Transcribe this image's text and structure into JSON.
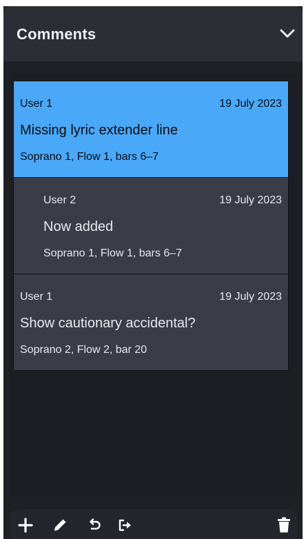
{
  "panel": {
    "title": "Comments",
    "collapse_icon": "chevron-down-icon"
  },
  "comments": [
    {
      "author": "User 1",
      "date": "19 July 2023",
      "text": "Missing lyric extender line",
      "location": "Soprano 1, Flow 1, bars 6–7",
      "selected": true,
      "reply": false
    },
    {
      "author": "User 2",
      "date": "19 July 2023",
      "text": "Now added",
      "location": "Soprano 1, Flow 1, bars 6–7",
      "selected": false,
      "reply": true
    },
    {
      "author": "User 1",
      "date": "19 July 2023",
      "text": "Show cautionary accidental?",
      "location": "Soprano 2, Flow 2, bar 20",
      "selected": false,
      "reply": false
    }
  ],
  "toolbar": {
    "icons": [
      "plus-icon",
      "pencil-icon",
      "reply-icon",
      "export-icon",
      "trash-icon"
    ]
  },
  "colors": {
    "selected_background": "#49a8f8",
    "comment_background": "#3a3d48",
    "panel_background": "#1f2026"
  }
}
